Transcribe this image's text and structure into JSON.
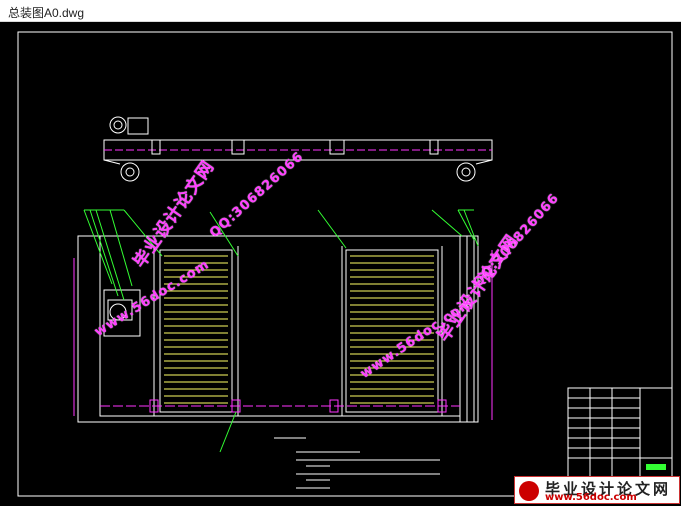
{
  "window": {
    "title": "总装图A0.dwg"
  },
  "colors": {
    "background": "#000000",
    "frame": "#ffffff",
    "part_lines": "#ffffff",
    "rollers": "#ffff66",
    "centerline": "#ff33ff",
    "leaders": "#33ff33",
    "watermark": "#ff33ff"
  },
  "watermarks": [
    {
      "text": "毕业设计论文网"
    },
    {
      "text": "QQ:306826066"
    },
    {
      "text": "www.56doc.com"
    },
    {
      "text": "QQ:306826066"
    },
    {
      "text": "www.56doc.com"
    },
    {
      "text": "毕业设计论文网"
    }
  ],
  "logo": {
    "icon": "logo-badge-icon",
    "title": "毕业设计论文网",
    "url": "www.56doc.com"
  }
}
